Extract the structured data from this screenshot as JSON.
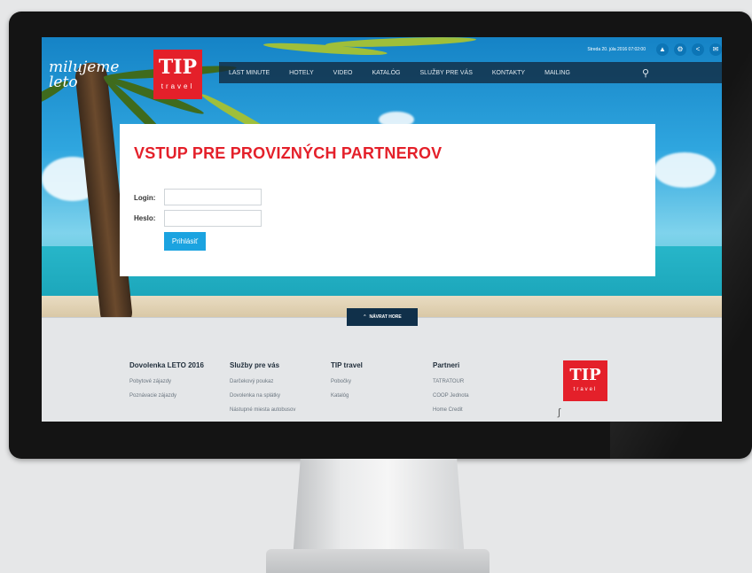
{
  "brand": {
    "slogan": "milujeme leto",
    "logo_main": "TIP",
    "logo_sub": "travel"
  },
  "topbar": {
    "date": "Streda 20. júla 2016 07:02:00",
    "icons": [
      "thumbs-up-icon",
      "gear-icon",
      "share-icon",
      "mail-icon"
    ]
  },
  "nav": {
    "items": [
      "LAST MINUTE",
      "HOTELY",
      "VIDEO",
      "KATALÓG",
      "SLUŽBY PRE VÁS",
      "KONTAKTY",
      "MAILING"
    ],
    "search_icon": "search-icon"
  },
  "login": {
    "title": "VSTUP PRE PROVIZNÝCH PARTNEROV",
    "login_label": "Login:",
    "login_value": "",
    "password_label": "Heslo:",
    "password_value": "",
    "submit_label": "Prihlásiť"
  },
  "back_to_top": {
    "label": "NÁVRAT HORE",
    "icon": "chevron-up-icon"
  },
  "footer": {
    "columns": [
      {
        "heading": "Dovolenka LETO 2016",
        "links": [
          "Pobytové zájazdy",
          "Poznávacie zájazdy"
        ]
      },
      {
        "heading": "Služby pre vás",
        "links": [
          "Darčekový poukaz",
          "Dovolenka na splátky",
          "Nástupné miesta autobusov"
        ]
      },
      {
        "heading": "TIP travel",
        "links": [
          "Pobočky",
          "Katalóg"
        ]
      },
      {
        "heading": "Partneri",
        "links": [
          "TATRATOUR",
          "COOP Jednota",
          "Home Credit"
        ]
      }
    ],
    "logo_main": "TIP",
    "logo_sub": "travel"
  },
  "colors": {
    "brand_red": "#e4202a",
    "accent_blue": "#1ba3e0",
    "nav_dark": "#10304a"
  }
}
